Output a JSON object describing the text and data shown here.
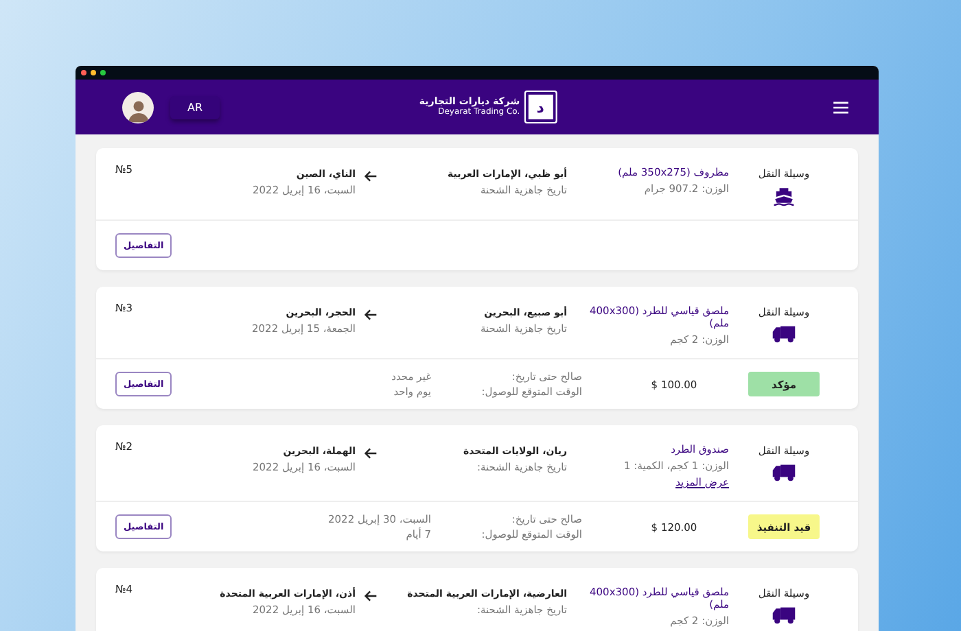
{
  "header": {
    "language": "AR",
    "logo": {
      "mark": "د",
      "name_ar": "شركة ديارات التجارية",
      "name_en": "Deyarat Trading Co."
    }
  },
  "orders": [
    {
      "number": "№5",
      "transport": {
        "label": "وسيلة النقل",
        "kind": "ship"
      },
      "item": {
        "title": "مظروف  (350x275 ملم)",
        "weight": "الوزن: 907.2 جرام"
      },
      "from": {
        "place": "أبو ظبي، الإمارات العربية",
        "note": "تاريخ جاهزية الشحنة"
      },
      "to": {
        "place": "الناي، الصين",
        "date": "السبت، 16 إبريل 2022"
      },
      "details_button": "التفاصيل"
    },
    {
      "number": "№3",
      "transport": {
        "label": "وسيلة النقل",
        "kind": "truck"
      },
      "item": {
        "title": "ملصق قياسي للطرد (400x300 ملم)",
        "weight": "الوزن: 2 كجم"
      },
      "from": {
        "place": "أبو صبيع، البحرين",
        "note": "تاريخ جاهزية الشحنة"
      },
      "to": {
        "place": "الحجر، البحرين",
        "date": "الجمعة، 15 إبريل 2022"
      },
      "status": {
        "label": "مؤكد",
        "kind": "confirmed"
      },
      "price": "$ 100.00",
      "valid_label": "صالح حتى تاريخ:",
      "valid_value": "غير محدد",
      "eta_label": "الوقت المتوقع للوصول:",
      "eta_value": "يوم واحد",
      "details_button": "التفاصيل"
    },
    {
      "number": "№2",
      "transport": {
        "label": "وسيلة النقل",
        "kind": "truck"
      },
      "item": {
        "title": "صندوق الطرد",
        "weight": "الوزن: 1 كجم، الكمية: 1",
        "more_link": "عرض المزيد"
      },
      "from": {
        "place": "ريان، الولايات المتحدة",
        "note": "تاريخ جاهزية الشحنة:"
      },
      "to": {
        "place": "الهملة، البحرين",
        "date": "السبت، 16 إبريل 2022"
      },
      "status": {
        "label": "قيد التنفيذ",
        "kind": "in_progress"
      },
      "price": "$ 120.00",
      "valid_label": "صالح حتى تاريخ:",
      "valid_value": "السبت، 30 إبريل 2022",
      "eta_label": "الوقت المتوقع للوصول:",
      "eta_value": "7 أيام",
      "details_button": "التفاصيل"
    },
    {
      "number": "№4",
      "transport": {
        "label": "وسيلة النقل",
        "kind": "truck"
      },
      "item": {
        "title": "ملصق قياسي للطرد (400x300 ملم)",
        "weight": "الوزن: 2 كجم"
      },
      "from": {
        "place": "العارضية، الإمارات العربية المتحدة",
        "note": "تاريخ جاهزية الشحنة:"
      },
      "to": {
        "place": "أذن، الإمارات العربية المتحدة",
        "date": "السبت، 16 إبريل 2022"
      }
    }
  ]
}
